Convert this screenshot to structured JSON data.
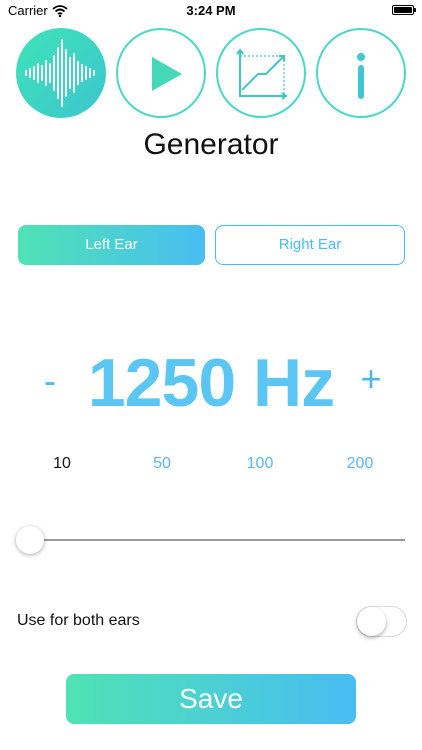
{
  "status_bar": {
    "carrier": "Carrier",
    "time": "3:24 PM",
    "battery_level": 1.0
  },
  "tabs": [
    {
      "name": "generator",
      "icon": "waveform-icon",
      "active": true
    },
    {
      "name": "play",
      "icon": "play-icon",
      "active": false
    },
    {
      "name": "graph",
      "icon": "chart-icon",
      "active": false
    },
    {
      "name": "info",
      "icon": "info-icon",
      "active": false
    }
  ],
  "title": "Generator",
  "ear_selector": {
    "left": "Left Ear",
    "right": "Right Ear",
    "selected": "Left Ear"
  },
  "frequency": {
    "value": "1250 Hz",
    "minus": "-",
    "plus": "+"
  },
  "steps": {
    "items": [
      "10",
      "50",
      "100",
      "200"
    ],
    "selected": "10"
  },
  "slider": {
    "level": 0.0
  },
  "both_ears": {
    "label": "Use for both ears",
    "enabled": false
  },
  "save_button": "Save",
  "colors": {
    "accent_green": "#4fe3b4",
    "accent_blue": "#48bdf2",
    "text_blue": "#5bc6f3"
  }
}
